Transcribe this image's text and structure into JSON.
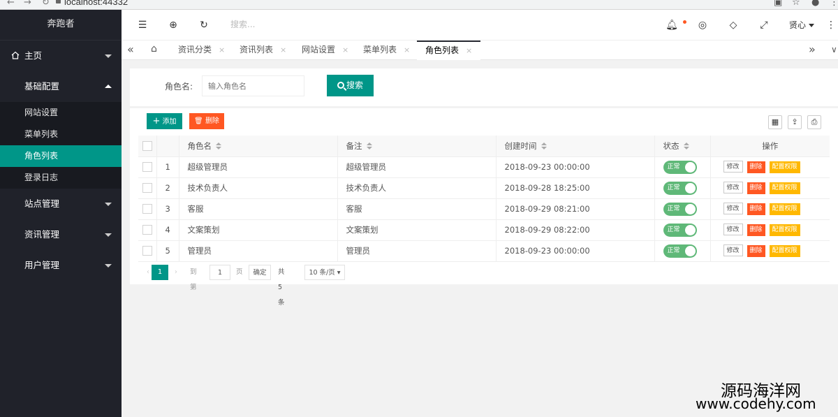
{
  "browser": {
    "url": "localhost:44332"
  },
  "sidebar": {
    "brand": "奔跑者",
    "home": "主页",
    "group_basic": "基础配置",
    "sub_items": [
      "网站设置",
      "菜单列表",
      "角色列表",
      "登录日志"
    ],
    "group_site": "站点管理",
    "group_news": "资讯管理",
    "group_user": "用户管理"
  },
  "header": {
    "search_placeholder": "搜索...",
    "user_name": "贤心"
  },
  "tabs": {
    "items": [
      "资讯分类",
      "资讯列表",
      "网站设置",
      "菜单列表",
      "角色列表"
    ],
    "active": "角色列表",
    "close": "×"
  },
  "search": {
    "label": "角色名:",
    "placeholder": "输入角色名",
    "button": "搜索"
  },
  "toolbar": {
    "add": "添加",
    "delete": "删除"
  },
  "table": {
    "headers": {
      "name": "角色名",
      "remark": "备注",
      "created": "创建时间",
      "status": "状态",
      "ops": "操作"
    },
    "rows": [
      {
        "index": "1",
        "name": "超级管理员",
        "remark": "超级管理员",
        "created": "2018-09-23 00:00:00",
        "status": "正常"
      },
      {
        "index": "2",
        "name": "技术负责人",
        "remark": "技术负责人",
        "created": "2018-09-28 18:25:00",
        "status": "正常"
      },
      {
        "index": "3",
        "name": "客服",
        "remark": "客服",
        "created": "2018-09-29 08:21:00",
        "status": "正常"
      },
      {
        "index": "4",
        "name": "文案策划",
        "remark": "文案策划",
        "created": "2018-09-29 08:22:00",
        "status": "正常"
      },
      {
        "index": "5",
        "name": "管理员",
        "remark": "管理员",
        "created": "2018-09-23 00:00:00",
        "status": "正常"
      }
    ],
    "op_edit": "修改",
    "op_delete": "删除",
    "op_perm": "配置权限"
  },
  "pager": {
    "current": "1",
    "goto_label": "到第",
    "goto_value": "1",
    "page_unit": "页",
    "confirm": "确定",
    "total": "共 5 条",
    "page_size": "10 条/页"
  },
  "watermark": {
    "line1": "源码海洋网",
    "line2": "www.codehy.com"
  }
}
